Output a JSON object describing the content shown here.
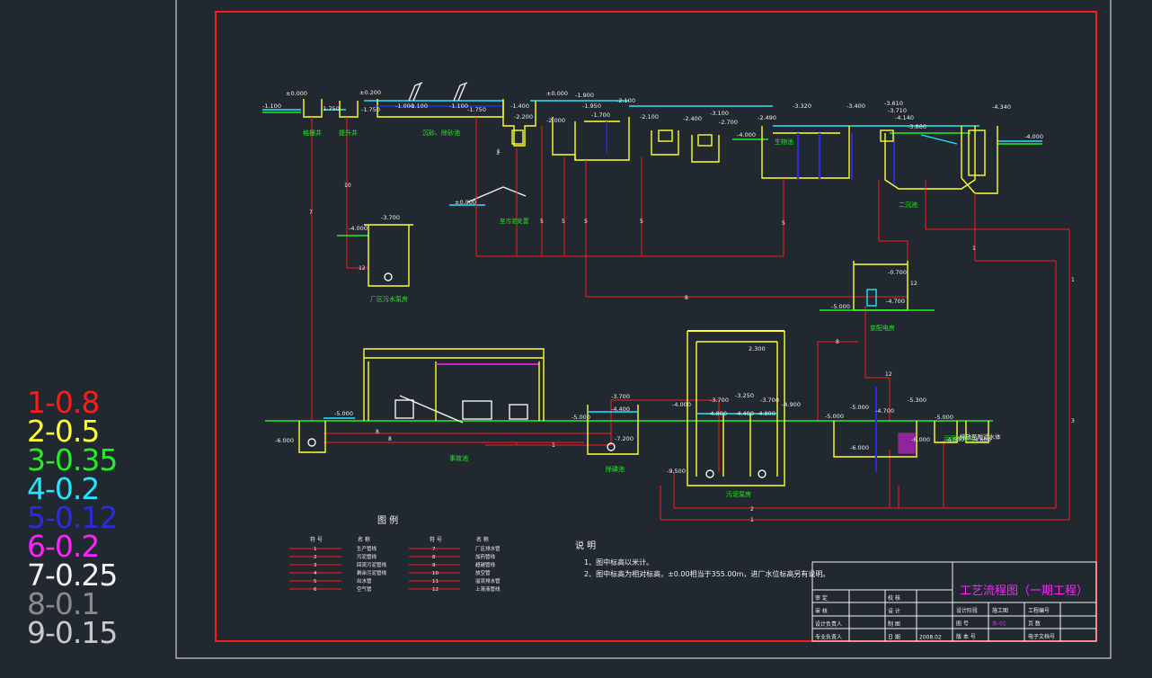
{
  "pen_legend": [
    {
      "text": "1-0.8",
      "color": "#ff1a1a"
    },
    {
      "text": "2-0.5",
      "color": "#ffff33"
    },
    {
      "text": "3-0.35",
      "color": "#22ee22"
    },
    {
      "text": "4-0.2",
      "color": "#22e6ff"
    },
    {
      "text": "5-0.12",
      "color": "#2b2bdd"
    },
    {
      "text": "6-0.2",
      "color": "#ff22ff"
    },
    {
      "text": "7-0.25",
      "color": "#f2f2f2"
    },
    {
      "text": "8-0.1",
      "color": "#8a8a8a"
    },
    {
      "text": "9-0.15",
      "color": "#c8c8c8"
    }
  ],
  "elevations_top": [
    "-1.100",
    "±0.000",
    "-1.750",
    "±0.200",
    "-1.750",
    "-1.000",
    "-1.100",
    "-1.100",
    "-1.750",
    "±0.000",
    "-1.900",
    "-1.400",
    "-2.200",
    "-2.100",
    "-1.950",
    "-1.700",
    "-2.000",
    "-2.100",
    "-2.400",
    "-2.700",
    "-3.100",
    "-4.000",
    "-2.490",
    "-3.320",
    "-3.400",
    "-3.610",
    "-3.710",
    "-4.140",
    "-3.860",
    "-4.340",
    "-4.000"
  ],
  "elevations_mid": [
    "-4.000",
    "-3.700",
    "-0.700",
    "-4.700",
    "-5.000",
    "±0.000",
    "2.300"
  ],
  "elevations_bottom": [
    "-5.000",
    "-6.000",
    "-3.700",
    "-4.400",
    "-5.000",
    "-7.200",
    "-4.000",
    "-3.700",
    "-4.800",
    "-3.250",
    "-4.400",
    "-3.700",
    "-4.800",
    "-4.900",
    "-9.500",
    "-5.000",
    "-5.000",
    "-4.700",
    "-5.300",
    "-6.000",
    "-6.000",
    "-5.000",
    "-4.600",
    "-4.600"
  ],
  "structure_labels": [
    "格栅井",
    "提升井",
    "沉砂、除砂池",
    "生物池",
    "二沉池",
    "厂区污水泵房",
    "事故池",
    "除磷池",
    "污泥泵房",
    "变配电房",
    "污泥浓缩池"
  ],
  "legend_title": "图  例",
  "legend_headers": [
    "符  号",
    "名  称",
    "符  号",
    "名  称"
  ],
  "legend_rows": [
    {
      "left_num": "1",
      "left_name": "生产管线",
      "right_num": "7",
      "right_name": "厂区排水管"
    },
    {
      "left_num": "2",
      "left_name": "污泥管线",
      "right_num": "8",
      "right_name": "加药管线"
    },
    {
      "left_num": "3",
      "left_name": "回流污泥管线",
      "right_num": "9",
      "right_name": "超越管线"
    },
    {
      "left_num": "4",
      "left_name": "剩余污泥管线",
      "right_num": "10",
      "right_name": "放空管"
    },
    {
      "left_num": "5",
      "left_name": "出水管",
      "right_num": "11",
      "right_name": "溢流排水管"
    },
    {
      "left_num": "6",
      "left_name": "空气管",
      "right_num": "12",
      "right_name": "上清液管线"
    }
  ],
  "notes_title": "说  明",
  "notes": [
    "1、图中标高以米计。",
    "2、图中标高为相对标高，±0.00相当于355.00m，进厂水位标高另有说明。"
  ],
  "title_block": {
    "drawing_title": "工艺流程图（一期工程）",
    "rows": [
      [
        "审  定",
        "",
        "校  核",
        ""
      ],
      [
        "审  核",
        "",
        "设  计",
        ""
      ],
      [
        "设计负责人",
        "",
        "制  图",
        ""
      ],
      [
        "专业负责人",
        "",
        "日  期",
        "2008.02"
      ]
    ],
    "right_rows": [
      [
        "设计阶段",
        "施工图",
        "工程编号",
        ""
      ],
      [
        "图  号",
        "水-01",
        "页  数",
        ""
      ],
      [
        "版 本 号",
        "",
        "电子文档号",
        ""
      ]
    ]
  },
  "pipe_numbers": [
    "7",
    "10",
    "12",
    "1",
    "5",
    "5",
    "5",
    "5",
    "8",
    "5",
    "1",
    "12",
    "8",
    "12",
    "3",
    "2",
    "1",
    "8",
    "8",
    "1",
    "1",
    "1"
  ],
  "side_labels": [
    "排放至附近水体",
    "至污泥处置"
  ]
}
